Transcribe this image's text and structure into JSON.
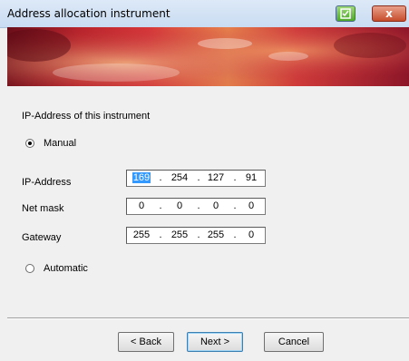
{
  "window": {
    "title": "Address allocation instrument"
  },
  "titlebar": {
    "help_icon": "help-icon",
    "close_icon": "close-icon",
    "close_glyph": "x"
  },
  "section": {
    "label": "IP-Address of this instrument"
  },
  "mode": {
    "manual_label": "Manual",
    "manual_checked": true,
    "automatic_label": "Automatic",
    "automatic_checked": false
  },
  "fields": [
    {
      "label": "IP-Address",
      "octets": [
        "169",
        "254",
        "127",
        "91"
      ],
      "selected_octet": 0
    },
    {
      "label": "Net mask",
      "octets": [
        "0",
        "0",
        "0",
        "0"
      ]
    },
    {
      "label": "Gateway",
      "octets": [
        "255",
        "255",
        "255",
        "0"
      ]
    }
  ],
  "ip_separator": ".",
  "buttons": {
    "back": "< Back",
    "next": "Next >",
    "cancel": "Cancel"
  },
  "colors": {
    "selection": "#3399ff",
    "banner_red": "#c62d32"
  }
}
